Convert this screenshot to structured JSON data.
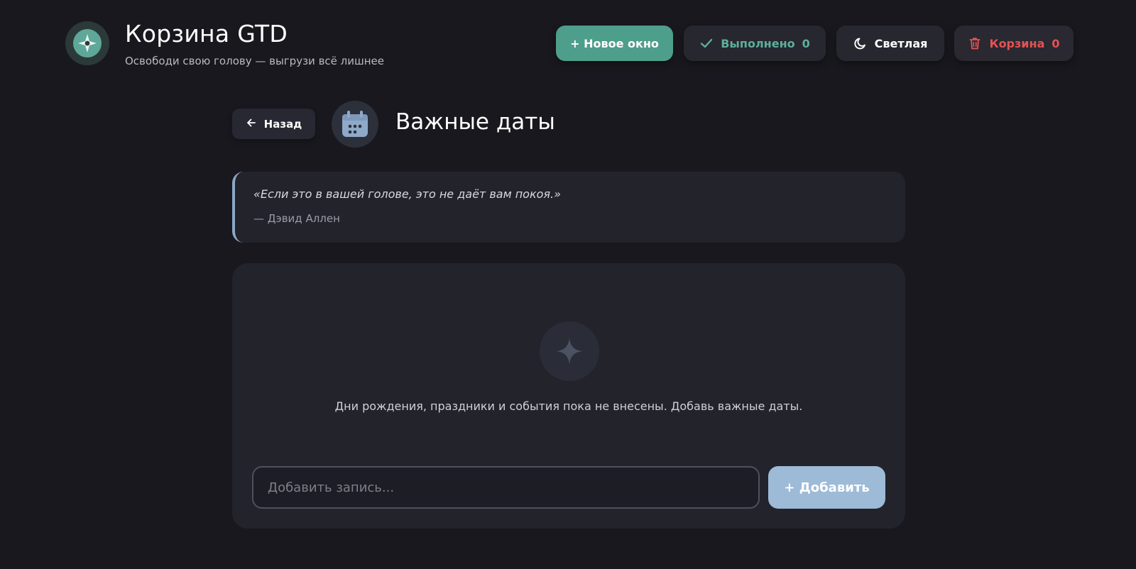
{
  "header": {
    "title": "Корзина GTD",
    "subtitle": "Освободи свою голову — выгрузи всё лишнее",
    "new_window_label": "+ Новое окно",
    "done_label": "Выполнено",
    "done_count": "0",
    "theme_label": "Светлая",
    "trash_label": "Корзина",
    "trash_count": "0"
  },
  "page": {
    "back_label": "Назад",
    "title": "Важные даты"
  },
  "quote": {
    "text": "«Если это в вашей голове, это не даёт вам покоя.»",
    "author": "— Дэвид Аллен"
  },
  "card": {
    "empty_text": "Дни рождения, праздники и события пока не внесены. Добавь важные даты.",
    "input_placeholder": "Добавить запись...",
    "input_value": "",
    "add_label": "+ Добавить"
  },
  "icons": {
    "logo": "compass-star-icon",
    "done": "check-icon",
    "theme": "moon-icon",
    "trash": "trash-icon",
    "back": "arrow-left-icon",
    "page": "calendar-icon",
    "empty": "sparkle-icon"
  },
  "colors": {
    "background": "#19181e",
    "accent_green": "#4e9e8c",
    "done_text": "#5fae99",
    "trash_red": "#e25454",
    "quote_border": "#8aa7c7",
    "add_button": "#9dbad7"
  }
}
